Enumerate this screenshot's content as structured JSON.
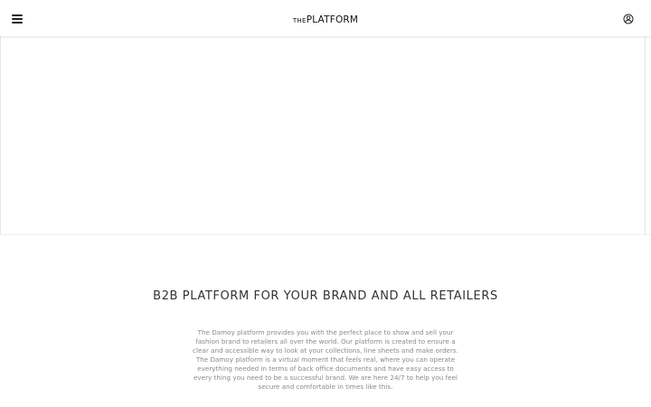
{
  "header": {
    "logo_prefix": "THE",
    "logo_main": "PLATFORM",
    "menu_icon": "hamburger-menu-icon",
    "account_icon": "user-circle-icon"
  },
  "main": {
    "title": "B2B PLATFORM FOR YOUR BRAND AND ALL RETAILERS",
    "description": "The Damoy platform provides you with the perfect place to show and sell your fashion brand to retailers all over the world. Our platform is created to ensure a clear and accessible way to look at your collections, line sheets and make orders. The Damoy platform is a virtual moment that feels real, where you can operate everything needed in terms of back office documents and have easy access to every thing you need to be a successful brand. We are here 24/7 to help you feel secure and comfortable in times like this."
  },
  "colors": {
    "text_dark": "#333333",
    "text_muted": "#8a8a8a",
    "background": "#ffffff"
  }
}
